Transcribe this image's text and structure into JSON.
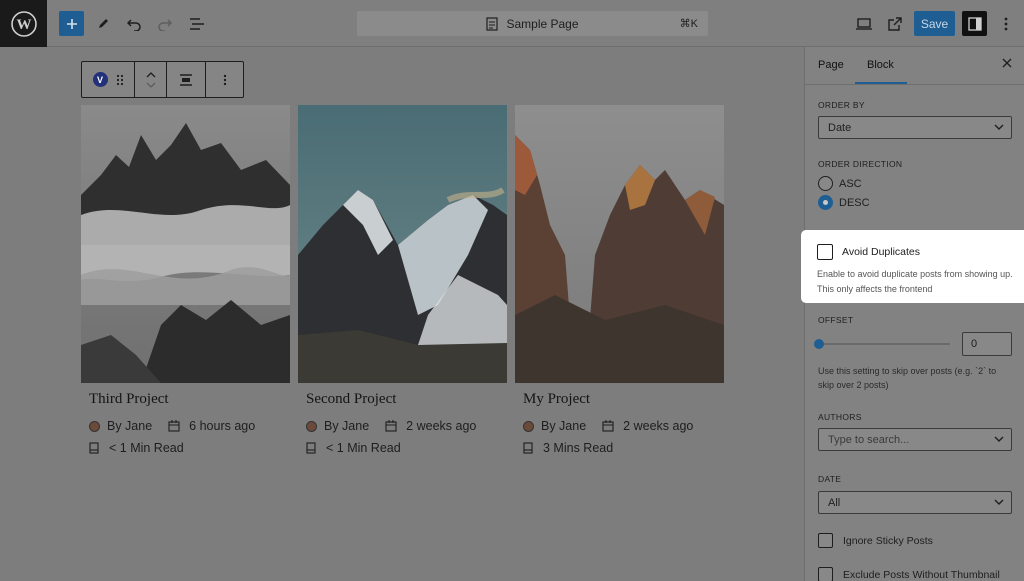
{
  "header": {
    "doc_title": "Sample Page",
    "shortcut": "⌘K",
    "save_label": "Save"
  },
  "cards": [
    {
      "title": "Third Project",
      "author": "By Jane",
      "date": "6 hours ago",
      "read": "< 1 Min Read"
    },
    {
      "title": "Second Project",
      "author": "By Jane",
      "date": "2 weeks ago",
      "read": "< 1 Min Read"
    },
    {
      "title": "My Project",
      "author": "By Jane",
      "date": "2 weeks ago",
      "read": "3 Mins Read"
    }
  ],
  "block_toolbar": {
    "badge": "V"
  },
  "sidebar": {
    "tabs": [
      "Page",
      "Block"
    ],
    "order_by": {
      "label": "ORDER BY",
      "value": "Date"
    },
    "order_direction": {
      "label": "ORDER DIRECTION",
      "options": [
        "ASC",
        "DESC"
      ],
      "selected": "DESC"
    },
    "avoid_duplicates": {
      "label": "Avoid Duplicates",
      "help": "Enable to avoid duplicate posts from showing up. This only affects the frontend",
      "checked": false
    },
    "offset": {
      "label": "OFFSET",
      "value": "0",
      "help": "Use this setting to skip over posts (e.g. `2` to skip over 2 posts)"
    },
    "authors": {
      "label": "AUTHORS",
      "placeholder": "Type to search..."
    },
    "date": {
      "label": "DATE",
      "value": "All"
    },
    "ignore_sticky": {
      "label": "Ignore Sticky Posts",
      "checked": false
    },
    "exclude_no_thumb": {
      "label": "Exclude Posts Without Thumbnail",
      "checked": false
    }
  },
  "colors": {
    "accent": "#1e5e93",
    "highlight": "#ffffff"
  }
}
